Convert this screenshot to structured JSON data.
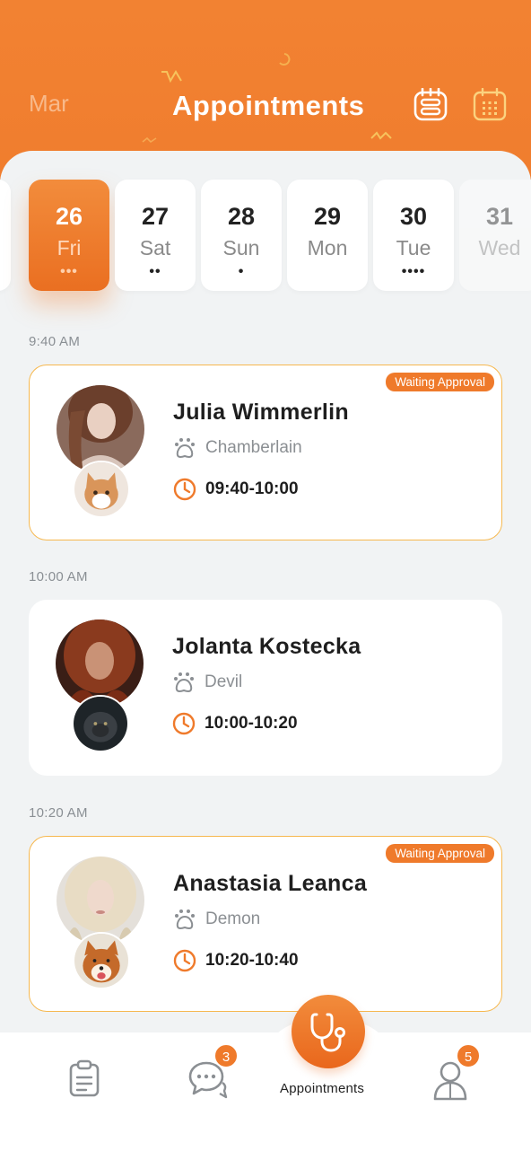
{
  "header": {
    "month": "Mar",
    "title": "Appointments",
    "list_icon": "list-icon",
    "calendar_icon": "calendar-icon"
  },
  "dates": [
    {
      "num": "26",
      "day": "Fri",
      "dots": "•••",
      "selected": true
    },
    {
      "num": "27",
      "day": "Sat",
      "dots": "••"
    },
    {
      "num": "28",
      "day": "Sun",
      "dots": "•"
    },
    {
      "num": "29",
      "day": "Mon",
      "dots": ""
    },
    {
      "num": "30",
      "day": "Tue",
      "dots": "••••"
    },
    {
      "num": "31",
      "day": "Wed",
      "dots": ""
    }
  ],
  "appointments": [
    {
      "time_label": "9:40 AM",
      "name": "Julia Wimmerlin",
      "pet": "Chamberlain",
      "range": "09:40-10:00",
      "badge": "Waiting Approval"
    },
    {
      "time_label": "10:00 AM",
      "name": "Jolanta Kostecka",
      "pet": "Devil",
      "range": "10:00-10:20",
      "badge": ""
    },
    {
      "time_label": "10:20 AM",
      "name": "Anastasia Leanca",
      "pet": "Demon",
      "range": "10:20-10:40",
      "badge": "Waiting Approval"
    }
  ],
  "nav": {
    "messages_count": "3",
    "profile_count": "5",
    "center_label": "Appointments",
    "icons": [
      "clipboard-icon",
      "chat-icon",
      "stethoscope-icon",
      "user-icon"
    ]
  },
  "colors": {
    "accent": "#ef7a2b",
    "header": "#f28232",
    "pending_border": "#f6b84f"
  }
}
